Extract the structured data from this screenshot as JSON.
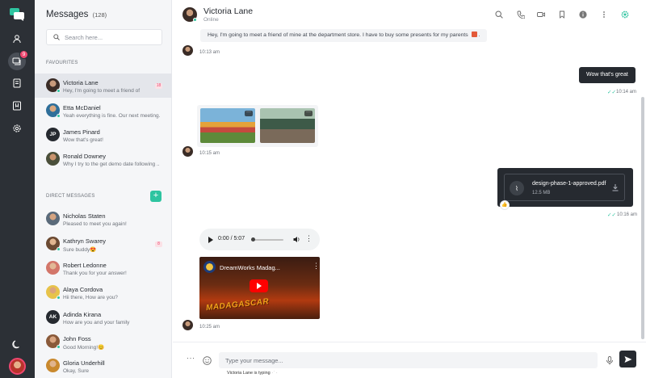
{
  "nav": {
    "chats_badge": "9"
  },
  "sidebar": {
    "title": "Messages",
    "count": "(128)",
    "search_placeholder": "Search here...",
    "favourites_label": "Favourites",
    "favourites": [
      {
        "name": "Victoria Lane",
        "preview": "Hey, I'm going to meet a friend of",
        "unread": "18"
      },
      {
        "name": "Etta McDaniel",
        "preview": "Yeah everything is fine. Our next meeting..."
      },
      {
        "name": "James Pinard",
        "preview": "Wow that's great!",
        "initials": "JP"
      },
      {
        "name": "Ronald Downey",
        "preview": "Why I try to the get demo date following ..."
      }
    ],
    "direct_label": "Direct Messages",
    "add_label": "+",
    "direct": [
      {
        "name": "Nicholas Staten",
        "preview": "Pleased to meet you again!"
      },
      {
        "name": "Kathryn Swarey",
        "preview": "Sure buddy😍",
        "unread": "8"
      },
      {
        "name": "Robert Ledonne",
        "preview": "Thank you for your answer!"
      },
      {
        "name": "Alaya Cordova",
        "preview": "Hii there, How are you?"
      },
      {
        "name": "Adinda Kirana",
        "preview": "How are you and your family",
        "initials": "AK"
      },
      {
        "name": "John Foss",
        "preview": "Good Morning!😊"
      },
      {
        "name": "Gloria Underhill",
        "preview": "Okay, Sure"
      }
    ]
  },
  "chat": {
    "contact_name": "Victoria Lane",
    "contact_status": "Online",
    "messages": {
      "m1_text": "Hey, I'm going to meet a friend of mine at the department store. I have to buy some presents for my parents",
      "m1_time": "10:13 am",
      "m2_text": "Wow that's great",
      "m2_time": "10:14 am",
      "m3_time": "10:15 am",
      "m4_file_name": "design-phase-1-approved.pdf",
      "m4_file_size": "12.5 MB",
      "m4_time": "10:16 am",
      "m5_audio_time": "0:00 / 5:07",
      "m5_video_title": "DreamWorks Madag...",
      "m5_video_art": "MADAGASCAR",
      "m5_time": "10:25 am"
    },
    "composer_placeholder": "Type your message...",
    "typing_text": "Victoria Lane is typing"
  },
  "colors": {
    "accent": "#2ec4a0",
    "rail": "#2c3036",
    "dark_bubble": "#262a30",
    "badge": "#ef476f"
  }
}
